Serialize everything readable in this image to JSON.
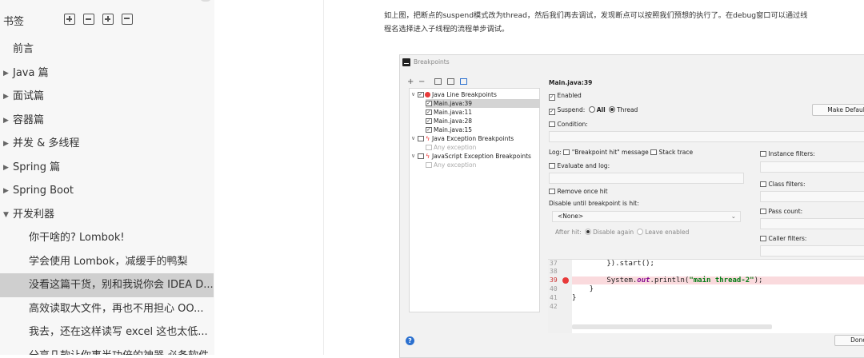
{
  "sidebar": {
    "bookmark_label": "书签",
    "items": [
      {
        "label": "前言",
        "arrow": ""
      },
      {
        "label": "Java 篇",
        "arrow": "▶"
      },
      {
        "label": "面试篇",
        "arrow": "▶"
      },
      {
        "label": "容器篇",
        "arrow": "▶"
      },
      {
        "label": "并发 & 多线程",
        "arrow": "▶"
      },
      {
        "label": "Spring 篇",
        "arrow": "▶"
      },
      {
        "label": "Spring Boot",
        "arrow": "▶"
      },
      {
        "label": "开发利器",
        "arrow": "▼"
      },
      {
        "label": "你干啥的? Lombok!",
        "arrow": ""
      },
      {
        "label": "学会使用 Lombok，减缓手的鸭梨",
        "arrow": ""
      },
      {
        "label": "没看这篇干货，别和我说你会 IDEA D...",
        "arrow": ""
      },
      {
        "label": "高效读取大文件，再也不用担心 OO...",
        "arrow": ""
      },
      {
        "label": "我去，还在这样读写 excel 这也太低...",
        "arrow": ""
      },
      {
        "label": "分享几款让你事半功倍的神器 必备软件",
        "arrow": ""
      }
    ]
  },
  "article": {
    "line1": "如上图，把断点的suspend模式改为thread，然后我们再去调试，发现断点可以按照我们预想的执行了。在debug窗口可以通过线",
    "line2": "程名选择进入子线程的流程单步调试。"
  },
  "dialog": {
    "title": "Breakpoints",
    "toolbar": {
      "add": "+",
      "remove": "−"
    },
    "tree": {
      "java_line": "Java Line Breakpoints",
      "items": [
        "Main.java:39",
        "Main.java:11",
        "Main.java:28",
        "Main.java:15"
      ],
      "java_exception": "Java Exception Breakpoints",
      "any_exception": "Any exception",
      "js_exception": "JavaScript Exception Breakpoints",
      "any_exception2": "Any exception"
    },
    "props": {
      "heading": "Main.java:39",
      "enabled": "Enabled",
      "suspend": "Suspend:",
      "all": "All",
      "thread": "Thread",
      "make_default": "Make Default",
      "condition": "Condition:",
      "log": "Log:",
      "bp_hit": "\"Breakpoint hit\" message",
      "stack_trace": "Stack trace",
      "evaluate": "Evaluate and log:",
      "remove_once": "Remove once hit",
      "disable_until": "Disable until breakpoint is hit:",
      "none_option": "<None>",
      "after_hit": "After hit:",
      "disable_again": "Disable again",
      "leave_enabled": "Leave enabled",
      "instance_filters": "Instance filters:",
      "class_filters": "Class filters:",
      "pass_count": "Pass count:",
      "caller_filters": "Caller filters:"
    },
    "code": {
      "lines": [
        {
          "num": "37",
          "text": "        }).start();"
        },
        {
          "num": "38",
          "text": ""
        },
        {
          "num": "39",
          "text_pre": "        System.",
          "text_out": "out",
          "text_mid": ".println(",
          "text_str": "\"main thread-2\"",
          "text_post": ");"
        },
        {
          "num": "40",
          "text": "    }"
        },
        {
          "num": "41",
          "text": "}"
        },
        {
          "num": "42",
          "text": ""
        }
      ]
    },
    "help_label": "?",
    "done_label": "Done"
  }
}
